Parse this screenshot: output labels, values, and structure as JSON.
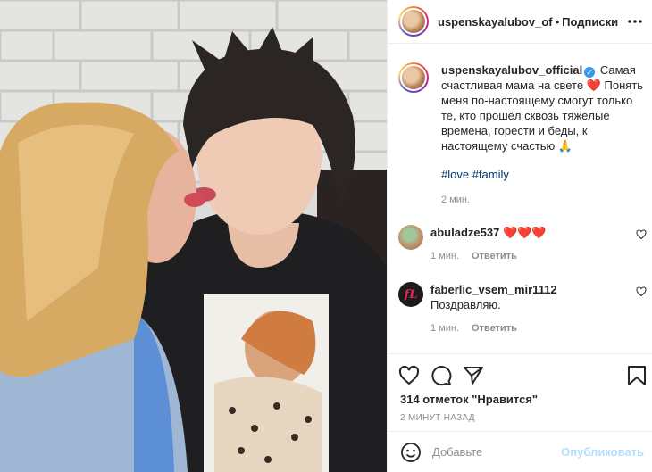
{
  "post": {
    "username": "uspenskayalubov_of",
    "dot": "•",
    "follow_label": "Подписки",
    "more_icon": "more-horizontal-icon"
  },
  "caption": {
    "username": "uspenskayalubov_official",
    "text_1": "Самая счастливая мама на свете",
    "text_2": "Понять меня по-настоящему смогут только те, кто прошёл сквозь тяжёлые времена, горести и беды, к настоящему счастью",
    "emoji_heart": "❤️",
    "emoji_pray": "🙏",
    "hashtags": "#love #family",
    "time": "2 мин."
  },
  "comments": [
    {
      "username": "abuladze537",
      "text": "❤️❤️❤️",
      "time": "1 мин.",
      "reply_label": "Ответить"
    },
    {
      "username": "faberlic_vsem_mir1112",
      "text": "Поздравляю.",
      "time": "1 мин.",
      "reply_label": "Ответить",
      "avatar_text": "fL"
    }
  ],
  "actions": {
    "likes": "314 отметок \"Нравится\"",
    "ago": "2 МИНУТ НАЗАД"
  },
  "add_comment": {
    "placeholder": "Добавьте",
    "post_label": "Опубликовать"
  },
  "colors": {
    "link": "#00376b",
    "meta": "#8e8e8e",
    "verified": "#3897f0",
    "post_disabled": "#b2dffc"
  }
}
